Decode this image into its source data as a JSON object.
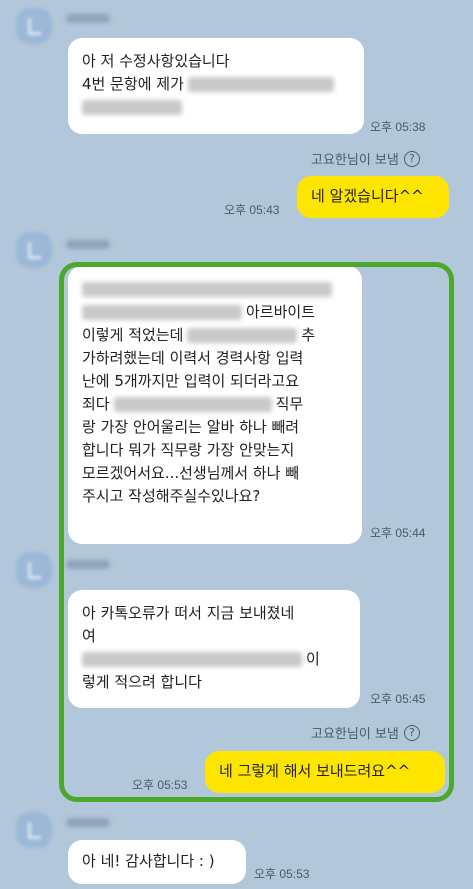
{
  "messages": {
    "m1": {
      "line1": "아 저 수정사항있습니다",
      "line2": "4번 문항에 제가",
      "time": "오후 05:38"
    },
    "notice1": {
      "text": "고요한님이 보냄",
      "icon": "?"
    },
    "m2": {
      "text": "네 알겠습니다^^",
      "time": "오후 05:43"
    },
    "m3": {
      "line1_suffix": "아르바이트",
      "line2_prefix": "이렇게 적었는데",
      "line2_suffix": "추",
      "line3": "가하려했는데 이력서 경력사항 입력",
      "line4": "난에 5개까지만 입력이 되더라고요",
      "line5_prefix": "죄다",
      "line5_suffix": "직무",
      "line6": "랑 가장 안어울리는 알바 하나 빼려",
      "line7": "합니다 뭐가 직무랑 가장 안맞는지",
      "line8": "모르겠어서요...선생님께서 하나 빼",
      "line9": "주시고 작성해주실수있나요?",
      "time": "오후 05:44"
    },
    "m4": {
      "line1": "아 카톡오류가 떠서 지금 보내졌네",
      "line2": "여",
      "line3_suffix": "이",
      "line4": "렇게 적으려 합니다",
      "time": "오후 05:45"
    },
    "notice2": {
      "text": "고요한님이 보냄",
      "icon": "?"
    },
    "m5": {
      "text": "네 그렇게 해서 보내드려요^^",
      "time": "오후 05:53"
    },
    "m6": {
      "text": "아 네! 감사합니다 : )",
      "time": "오후 05:53"
    }
  }
}
